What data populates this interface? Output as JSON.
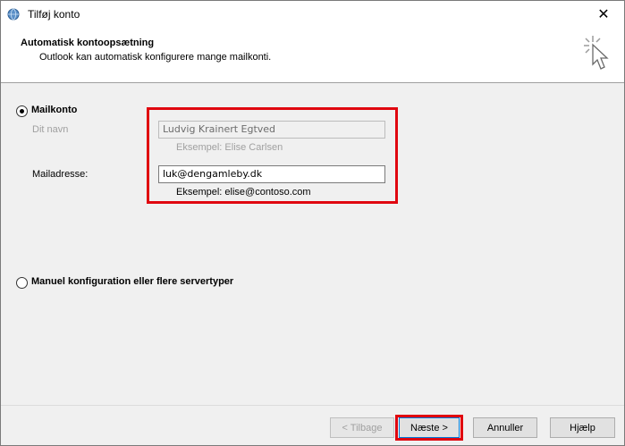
{
  "window": {
    "title": "Tilføj konto",
    "close_glyph": "✕"
  },
  "header": {
    "title": "Automatisk kontoopsætning",
    "subtitle": "Outlook kan automatisk konfigurere mange mailkonti."
  },
  "mail_account": {
    "radio_label": "Mailkonto",
    "selected": true,
    "name_label": "Dit navn",
    "name_value": "Ludvig Krainert Egtved",
    "name_example": "Eksempel: Elise Carlsen",
    "email_label": "Mailadresse:",
    "email_value": "luk@dengamleby.dk",
    "email_example": "Eksempel: elise@contoso.com"
  },
  "manual": {
    "radio_label": "Manuel konfiguration eller flere servertyper",
    "selected": false
  },
  "buttons": {
    "back": "< Tilbage",
    "next": "Næste >",
    "cancel": "Annuller",
    "help": "Hjælp"
  },
  "highlight_color": "#e0060f"
}
